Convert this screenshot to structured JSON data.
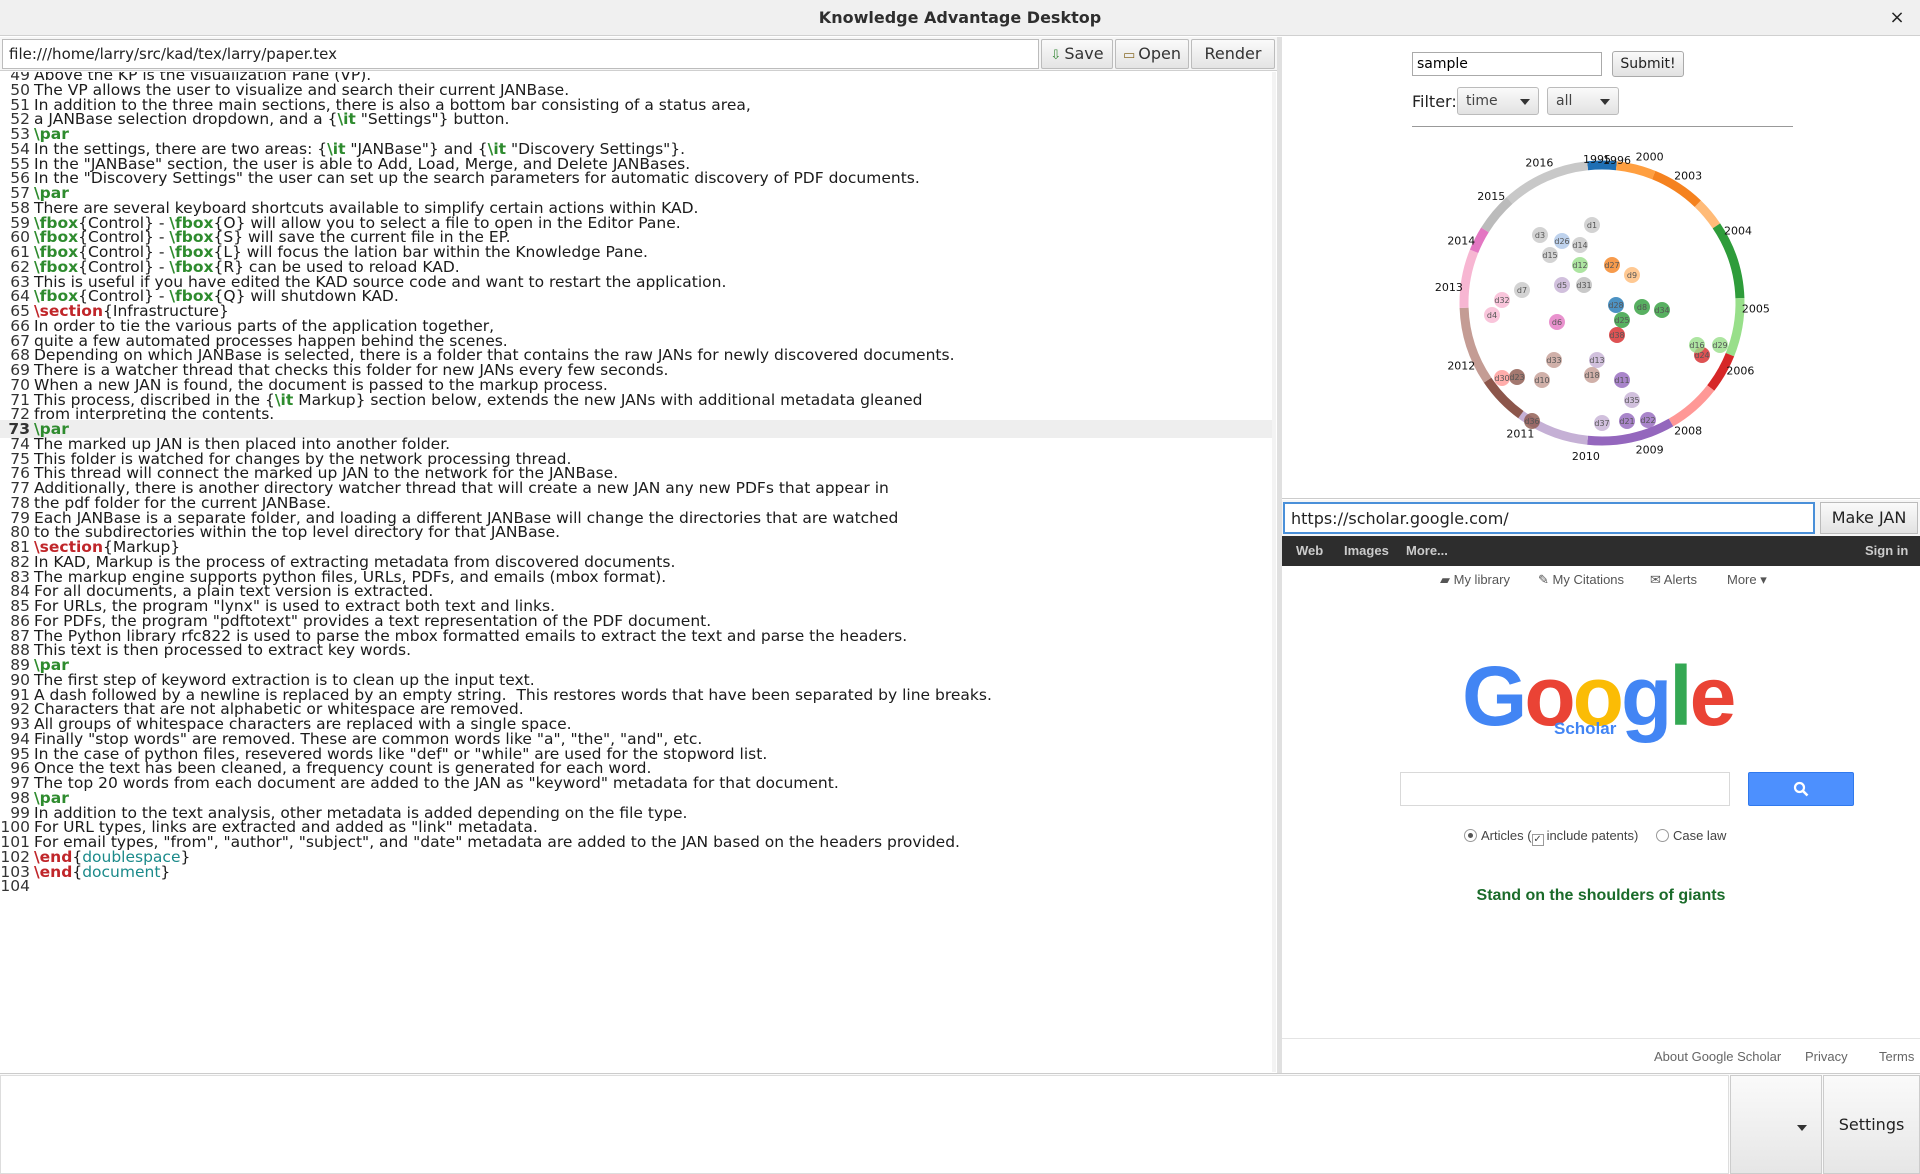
{
  "window": {
    "title": "Knowledge Advantage Desktop",
    "close_glyph": "×"
  },
  "toolbar": {
    "path": "file:///home/larry/src/kad/tex/larry/paper.tex",
    "save_label": "Save",
    "open_label": "Open",
    "render_label": "Render"
  },
  "editor": {
    "lines": [
      {
        "n": "49",
        "t": "Above the KP is the visualization Pane (VP)."
      },
      {
        "n": "50",
        "t": "The VP allows the user to visualize and search their current JANBase."
      },
      {
        "n": "51",
        "t": "In addition to the three main sections, there is also a bottom bar consisting of a status area,"
      },
      {
        "n": "52",
        "t": "a JANBase selection dropdown, and a {\\it \"Settings\"} button."
      },
      {
        "n": "53",
        "t": "\\par"
      },
      {
        "n": "54",
        "t": "In the settings, there are two areas: {\\it \"JANBase\"} and {\\it \"Discovery Settings\"}."
      },
      {
        "n": "55",
        "t": "In the \"JANBase\" section, the user is able to Add, Load, Merge, and Delete JANBases."
      },
      {
        "n": "56",
        "t": "In the \"Discovery Settings\" the user can set up the search parameters for automatic discovery of PDF documents."
      },
      {
        "n": "57",
        "t": "\\par"
      },
      {
        "n": "58",
        "t": "There are several keyboard shortcuts available to simplify certain actions within KAD."
      },
      {
        "n": "59",
        "t": "\\fbox{Control} - \\fbox{O} will allow you to select a file to open in the Editor Pane."
      },
      {
        "n": "60",
        "t": "\\fbox{Control} - \\fbox{S} will save the current file in the EP."
      },
      {
        "n": "61",
        "t": "\\fbox{Control} - \\fbox{L} will focus the lation bar within the Knowledge Pane."
      },
      {
        "n": "62",
        "t": "\\fbox{Control} - \\fbox{R} can be used to reload KAD."
      },
      {
        "n": "63",
        "t": "This is useful if you have edited the KAD source code and want to restart the application."
      },
      {
        "n": "64",
        "t": "\\fbox{Control} - \\fbox{Q} will shutdown KAD."
      },
      {
        "n": "65",
        "t": "\\section{Infrastructure}"
      },
      {
        "n": "66",
        "t": "In order to tie the various parts of the application together,"
      },
      {
        "n": "67",
        "t": "quite a few automated processes happen behind the scenes."
      },
      {
        "n": "68",
        "t": "Depending on which JANBase is selected, there is a folder that contains the raw JANs for newly discovered documents."
      },
      {
        "n": "69",
        "t": "There is a watcher thread that checks this folder for new JANs every few seconds."
      },
      {
        "n": "70",
        "t": "When a new JAN is found, the document is passed to the markup process."
      },
      {
        "n": "71",
        "t": "This process, discribed in the {\\it Markup} section below, extends the new JANs with additional metadata gleaned"
      },
      {
        "n": "72",
        "t": "from interpreting the contents."
      },
      {
        "n": "73",
        "t": "\\par"
      },
      {
        "n": "74",
        "t": "The marked up JAN is then placed into another folder."
      },
      {
        "n": "75",
        "t": "This folder is watched for changes by the network processing thread."
      },
      {
        "n": "76",
        "t": "This thread will connect the marked up JAN to the network for the JANBase."
      },
      {
        "n": "77",
        "t": "Additionally, there is another directory watcher thread that will create a new JAN any new PDFs that appear in"
      },
      {
        "n": "78",
        "t": "the pdf folder for the current JANBase."
      },
      {
        "n": "79",
        "t": "Each JANBase is a separate folder, and loading a different JANBase will change the directories that are watched"
      },
      {
        "n": "80",
        "t": "to the subdirectories within the top level directory for that JANBase."
      },
      {
        "n": "81",
        "t": "\\section{Markup}"
      },
      {
        "n": "82",
        "t": "In KAD, Markup is the process of extracting metadata from discovered documents."
      },
      {
        "n": "83",
        "t": "The markup engine supports python files, URLs, PDFs, and emails (mbox format)."
      },
      {
        "n": "84",
        "t": "For all documents, a plain text version is extracted."
      },
      {
        "n": "85",
        "t": "For URLs, the program \"lynx\" is used to extract both text and links."
      },
      {
        "n": "86",
        "t": "For PDFs, the program \"pdftotext\" provides a text representation of the PDF document."
      },
      {
        "n": "87",
        "t": "The Python library rfc822 is used to parse the mbox formatted emails to extract the text and parse the headers."
      },
      {
        "n": "88",
        "t": "This text is then processed to extract key words."
      },
      {
        "n": "89",
        "t": "\\par"
      },
      {
        "n": "90",
        "t": "The first step of keyword extraction is to clean up the input text."
      },
      {
        "n": "91",
        "t": "A dash followed by a newline is replaced by an empty string.  This restores words that have been separated by line breaks."
      },
      {
        "n": "92",
        "t": "Characters that are not alphabetic or whitespace are removed."
      },
      {
        "n": "93",
        "t": "All groups of whitespace characters are replaced with a single space."
      },
      {
        "n": "94",
        "t": "Finally \"stop words\" are removed. These are common words like \"a\", \"the\", \"and\", etc."
      },
      {
        "n": "95",
        "t": "In the case of python files, resevered words like \"def\" or \"while\" are used for the stopword list."
      },
      {
        "n": "96",
        "t": "Once the text has been cleaned, a frequency count is generated for each word."
      },
      {
        "n": "97",
        "t": "The top 20 words from each document are added to the JAN as \"keyword\" metadata for that document."
      },
      {
        "n": "98",
        "t": "\\par"
      },
      {
        "n": "99",
        "t": "In addition to the text analysis, other metadata is added depending on the file type."
      },
      {
        "n": "100",
        "t": "For URL types, links are extracted and added as \"link\" metadata."
      },
      {
        "n": "101",
        "t": "For email types, \"from\", \"author\", \"subject\", and \"date\" metadata are added to the JAN based on the headers provided."
      },
      {
        "n": "102",
        "t": "\\end{doublespace}"
      },
      {
        "n": "103",
        "t": "\\end{document}"
      },
      {
        "n": "104",
        "t": ""
      }
    ],
    "current_line": "73"
  },
  "viz": {
    "search_value": "sample",
    "submit_label": "Submit!",
    "filter_label": "Filter:",
    "filter_time": "time",
    "filter_all": "all",
    "year_labels": [
      "1995",
      "1996",
      "2000",
      "2003",
      "2004",
      "2005",
      "2006",
      "2008",
      "2009",
      "2010",
      "2011",
      "2012",
      "2013",
      "2014",
      "2015",
      "2016"
    ],
    "node_labels": [
      "d1",
      "d14",
      "d3",
      "d26",
      "d12",
      "d31",
      "d15",
      "d27",
      "d9",
      "d5",
      "d28",
      "d25",
      "d8",
      "d34",
      "d32",
      "d6",
      "d38",
      "d33",
      "d13",
      "d23",
      "d24",
      "d30",
      "d18",
      "d11",
      "d10",
      "d35",
      "d36",
      "d37",
      "d21",
      "d22",
      "d16",
      "d29",
      "d4",
      "d7"
    ],
    "colors": {
      "gray": "#c8c8c8",
      "blue": "#1f6fb4",
      "orange": "#f5821f",
      "green": "#2e9c3a",
      "red": "#d62728",
      "purple": "#9467bd",
      "brown": "#8c564b",
      "pink": "#e377c2"
    }
  },
  "browser": {
    "url": "https://scholar.google.com/",
    "make_jan_label": "Make JAN",
    "gbar": [
      "Web",
      "Images",
      "More...",
      "Sign in"
    ],
    "sub": [
      "My library",
      "My Citations",
      "Alerts",
      "More"
    ],
    "logo_letters": [
      "G",
      "o",
      "o",
      "g",
      "l",
      "e"
    ],
    "scholar": "Scholar",
    "opt_articles": "Articles (",
    "opt_patents": "include patents)",
    "opt_caselaw": "Case law",
    "tagline": "Stand on the shoulders of giants",
    "footer": [
      "About Google Scholar",
      "Privacy",
      "Terms"
    ]
  },
  "bottom": {
    "settings_label": "Settings"
  }
}
